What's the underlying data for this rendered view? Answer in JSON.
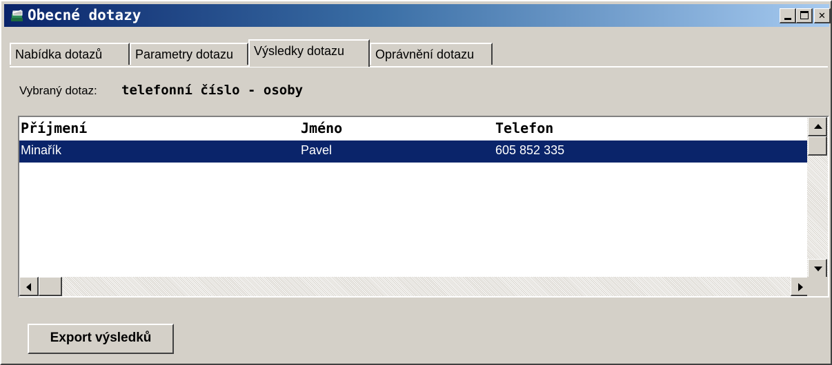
{
  "window": {
    "title": "Obecné dotazy",
    "icon": "books-icon"
  },
  "tabs": [
    {
      "label": "Nabídka dotazů",
      "active": false
    },
    {
      "label": "Parametry dotazu",
      "active": false
    },
    {
      "label": "Výsledky dotazu",
      "active": true
    },
    {
      "label": "Oprávnění dotazu",
      "active": false
    }
  ],
  "query": {
    "label": "Vybraný dotaz:",
    "value": "telefonní číslo - osoby"
  },
  "grid": {
    "columns": [
      "Příjmení",
      "Jméno",
      "Telefon"
    ],
    "rows": [
      {
        "surname": "Minařík",
        "name": "Pavel",
        "phone": "605 852 335",
        "selected": true
      }
    ]
  },
  "actions": {
    "export_label": "Export výsledků"
  },
  "colors": {
    "selection": "#0a246a",
    "face": "#d4d0c8"
  }
}
